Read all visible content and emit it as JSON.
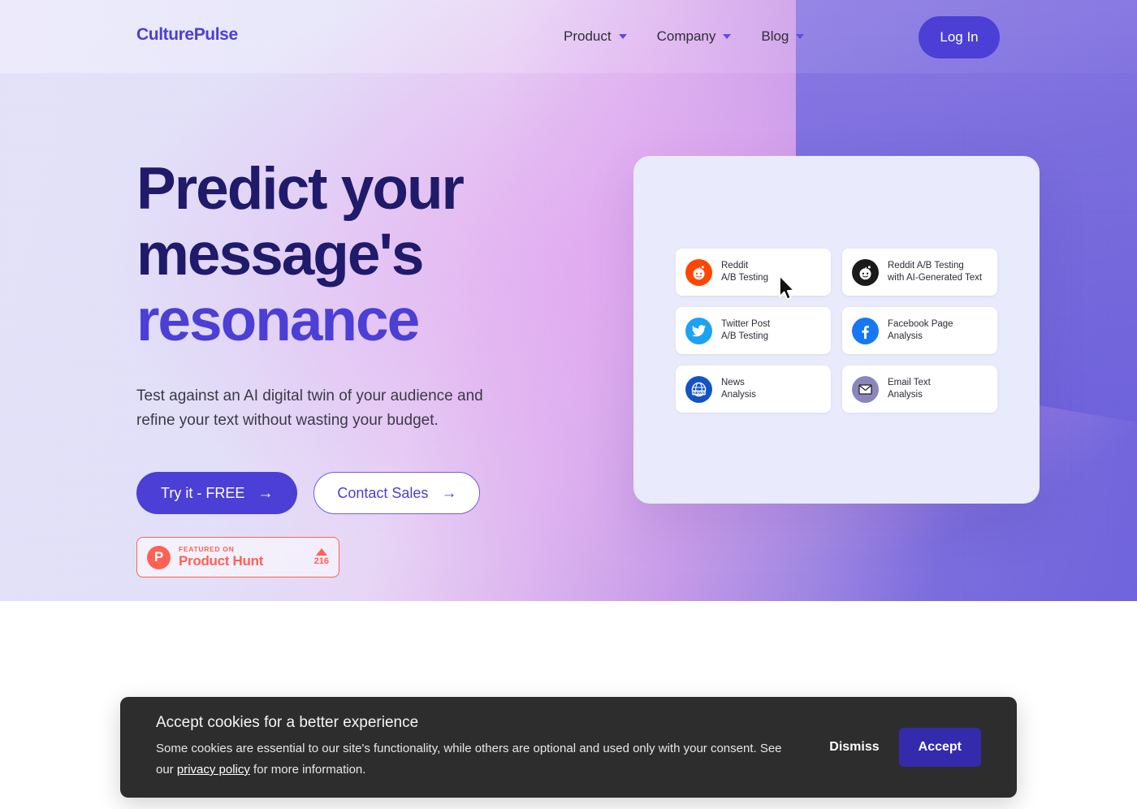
{
  "brand": {
    "name": "CulturePulse",
    "accent_color": "#4b3fd6",
    "headline_color": "#201a6b"
  },
  "nav": {
    "items": [
      {
        "label": "Product"
      },
      {
        "label": "Company"
      },
      {
        "label": "Blog"
      }
    ],
    "login_label": "Log In"
  },
  "hero": {
    "headline_line1": "Predict your",
    "headline_line2": "message's",
    "headline_accent": "resonance",
    "subtitle": "Test against an AI digital twin of your audience and refine your text without wasting your budget.",
    "primary_cta": "Try it - FREE",
    "primary_cta_arrow": "→",
    "secondary_cta": "Contact Sales",
    "secondary_cta_arrow": "→"
  },
  "product_hunt": {
    "featured_on": "FEATURED ON",
    "name": "Product Hunt",
    "upvotes": "216",
    "color": "#ff6154"
  },
  "panel": {
    "tiles": [
      {
        "title": "Reddit",
        "subtitle": "A/B Testing",
        "icon": "reddit-icon",
        "icon_color": "#ff4500"
      },
      {
        "title": "Reddit A/B Testing",
        "subtitle": "with AI-Generated Text",
        "icon": "reddit-dark-icon",
        "icon_color": "#1a1a1a"
      },
      {
        "title": "Twitter Post",
        "subtitle": "A/B Testing",
        "icon": "twitter-icon",
        "icon_color": "#1da1f2"
      },
      {
        "title": "Facebook Page",
        "subtitle": "Analysis",
        "icon": "facebook-icon",
        "icon_color": "#1877f2"
      },
      {
        "title": "News",
        "subtitle": "Analysis",
        "icon": "news-globe-icon",
        "icon_color": "#1453c4"
      },
      {
        "title": "Email Text",
        "subtitle": "Analysis",
        "icon": "email-envelope-icon",
        "icon_color": "#8a86bd"
      }
    ]
  },
  "cookie_banner": {
    "title": "Accept cookies for a better experience",
    "body_before_link": "Some cookies are essential to our site's functionality, while others are optional and used only with your consent. See our ",
    "link_label": "privacy policy",
    "body_after_link": " for more information.",
    "dismiss_label": "Dismiss",
    "accept_label": "Accept",
    "accent_color": "#332bab"
  }
}
